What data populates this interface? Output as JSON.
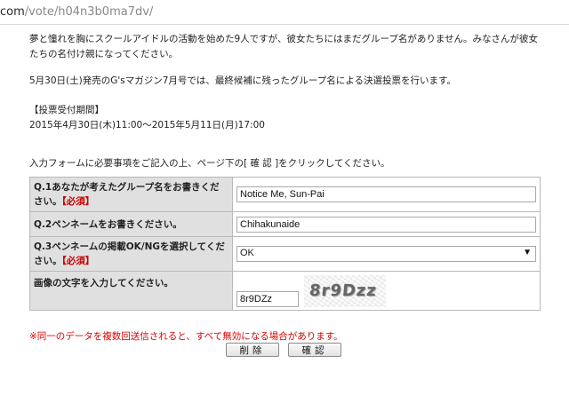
{
  "browser": {
    "url_prefix": "com",
    "url_path": "/vote/h04n3b0ma7dv/"
  },
  "intro": {
    "paragraph1": "夢と憧れを胸にスクールアイドルの活動を始めた9人ですが、彼女たちにはまだグループ名がありません。みなさんが彼女たちの名付け親になってください。",
    "paragraph2": "5月30日(土)発売のG'sマガジン7月号では、最終候補に残ったグループ名による決選投票を行います。",
    "period_heading": "【投票受付期間】",
    "period_value": "2015年4月30日(木)11:00～2015年5月11日(月)17:00",
    "instructions": "入力フォームに必要事項をご記入の上、ページ下の[ 確 認 ]をクリックしてください。"
  },
  "form": {
    "required_tag": "【必須】",
    "q1_label": "Q.1あなたが考えたグループ名をお書きください。",
    "q1_value": "Notice Me, Sun-Pai",
    "q2_label": "Q.2ペンネームをお書きください。",
    "q2_value": "Chihakunaide",
    "q3_label": "Q.3ペンネームの掲載OK/NGを選択してください。",
    "q3_value": "OK",
    "captcha_label": "画像の文字を入力してください。",
    "captcha_value": "8r9DZz",
    "captcha_image_text": "8r9Dzz"
  },
  "warning": "※同一のデータを複数回送信されると、すべて無効になる場合があります。",
  "buttons": {
    "delete": "削除",
    "confirm": "確認"
  }
}
